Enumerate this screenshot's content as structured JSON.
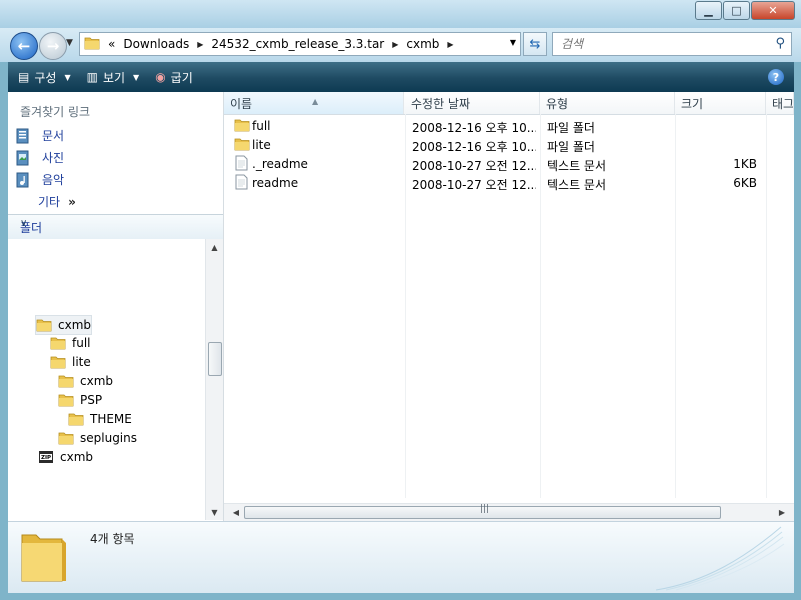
{
  "window": {
    "minimize_icon": "minimize-icon",
    "maximize_icon": "maximize-icon",
    "close_icon": "close-icon"
  },
  "address": {
    "overflow": "«",
    "crumbs": [
      "Downloads",
      "24532_cxmb_release_3.3.tar",
      "cxmb"
    ]
  },
  "search": {
    "placeholder": "검색"
  },
  "toolbar": {
    "organize": "구성",
    "views": "보기",
    "burn": "굽기"
  },
  "favorites": {
    "title": "즐겨찾기 링크",
    "items": [
      "문서",
      "사진",
      "음악"
    ],
    "more": "기타",
    "more_arrow": "»"
  },
  "folders_header": "폴더",
  "tree": [
    {
      "label": "cxmb",
      "type": "folder",
      "level": 0,
      "selected": true
    },
    {
      "label": "full",
      "type": "folder",
      "level": 1
    },
    {
      "label": "lite",
      "type": "folder",
      "level": 1
    },
    {
      "label": "cxmb",
      "type": "folder",
      "level": 2
    },
    {
      "label": "PSP",
      "type": "folder",
      "level": 2
    },
    {
      "label": "THEME",
      "type": "folder",
      "level": 3
    },
    {
      "label": "seplugins",
      "type": "folder",
      "level": 2
    },
    {
      "label": "cxmb",
      "type": "zip",
      "level": 0
    }
  ],
  "columns": [
    "이름",
    "수정한 날짜",
    "유형",
    "크기",
    "태그"
  ],
  "files": [
    {
      "name": "full",
      "icon": "folder-icon",
      "date": "2008-12-16 오후 10...",
      "type": "파일 폴더",
      "size": ""
    },
    {
      "name": "lite",
      "icon": "folder-icon",
      "date": "2008-12-16 오후 10...",
      "type": "파일 폴더",
      "size": ""
    },
    {
      "name": "._readme",
      "icon": "text-file-icon",
      "date": "2008-10-27 오전 12...",
      "type": "텍스트 문서",
      "size": "1KB"
    },
    {
      "name": "readme",
      "icon": "text-file-icon",
      "date": "2008-10-27 오전 12...",
      "type": "텍스트 문서",
      "size": "6KB"
    }
  ],
  "details": {
    "count": "4개 항목"
  },
  "colors": {
    "toolbar": "#1e4a62",
    "link": "#1e3e9b",
    "accent": "#1a63c4"
  }
}
